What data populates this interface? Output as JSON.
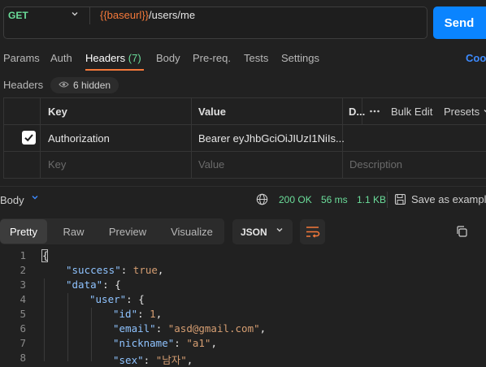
{
  "request": {
    "method": "GET",
    "url_variable": "{{baseurl}}",
    "url_path": "/users/me",
    "send_label": "Send"
  },
  "tabs": [
    {
      "label": "Params"
    },
    {
      "label": "Auth"
    },
    {
      "label": "Headers",
      "count": "(7)",
      "active": true
    },
    {
      "label": "Body"
    },
    {
      "label": "Pre-req."
    },
    {
      "label": "Tests"
    },
    {
      "label": "Settings"
    }
  ],
  "cookies_label": "Coo",
  "headers_section": {
    "title": "Headers",
    "hidden_label": "6 hidden",
    "columns": {
      "key": "Key",
      "value": "Value",
      "description": "D..."
    },
    "bulk_edit": "Bulk Edit",
    "presets": "Presets",
    "rows": [
      {
        "checked": true,
        "key": "Authorization",
        "value": "Bearer eyJhbGciOiJIUzI1NiIs..."
      }
    ],
    "placeholder": {
      "key": "Key",
      "value": "Value",
      "description": "Description"
    }
  },
  "response": {
    "body_label": "Body",
    "status": "200 OK",
    "time": "56 ms",
    "size": "1.1 KB",
    "save_label": "Save as example",
    "view_tabs": [
      "Pretty",
      "Raw",
      "Preview",
      "Visualize"
    ],
    "active_view": "Pretty",
    "format": "JSON",
    "lines": [
      {
        "n": "1",
        "indent": 0,
        "tokens": [
          {
            "t": "p",
            "v": "{"
          }
        ]
      },
      {
        "n": "2",
        "indent": 1,
        "tokens": [
          {
            "t": "k",
            "v": "\"success\""
          },
          {
            "t": "p",
            "v": ": "
          },
          {
            "t": "b",
            "v": "true"
          },
          {
            "t": "p",
            "v": ","
          }
        ]
      },
      {
        "n": "3",
        "indent": 1,
        "tokens": [
          {
            "t": "k",
            "v": "\"data\""
          },
          {
            "t": "p",
            "v": ": {"
          }
        ]
      },
      {
        "n": "4",
        "indent": 2,
        "tokens": [
          {
            "t": "k",
            "v": "\"user\""
          },
          {
            "t": "p",
            "v": ": {"
          }
        ]
      },
      {
        "n": "5",
        "indent": 3,
        "tokens": [
          {
            "t": "k",
            "v": "\"id\""
          },
          {
            "t": "p",
            "v": ": "
          },
          {
            "t": "n",
            "v": "1"
          },
          {
            "t": "p",
            "v": ","
          }
        ]
      },
      {
        "n": "6",
        "indent": 3,
        "tokens": [
          {
            "t": "k",
            "v": "\"email\""
          },
          {
            "t": "p",
            "v": ": "
          },
          {
            "t": "s",
            "v": "\"asd@gmail.com\""
          },
          {
            "t": "p",
            "v": ","
          }
        ]
      },
      {
        "n": "7",
        "indent": 3,
        "tokens": [
          {
            "t": "k",
            "v": "\"nickname\""
          },
          {
            "t": "p",
            "v": ": "
          },
          {
            "t": "s",
            "v": "\"a1\""
          },
          {
            "t": "p",
            "v": ","
          }
        ]
      },
      {
        "n": "8",
        "indent": 3,
        "tokens": [
          {
            "t": "k",
            "v": "\"sex\""
          },
          {
            "t": "p",
            "v": ": "
          },
          {
            "t": "s",
            "v": "\"남자\""
          },
          {
            "t": "p",
            "v": ","
          }
        ]
      }
    ]
  },
  "colors": {
    "accent": "#f5793a",
    "send": "#0a84ff",
    "success": "#6bdd9a",
    "json_key": "#8fc3ff",
    "json_value": "#d69e72"
  }
}
